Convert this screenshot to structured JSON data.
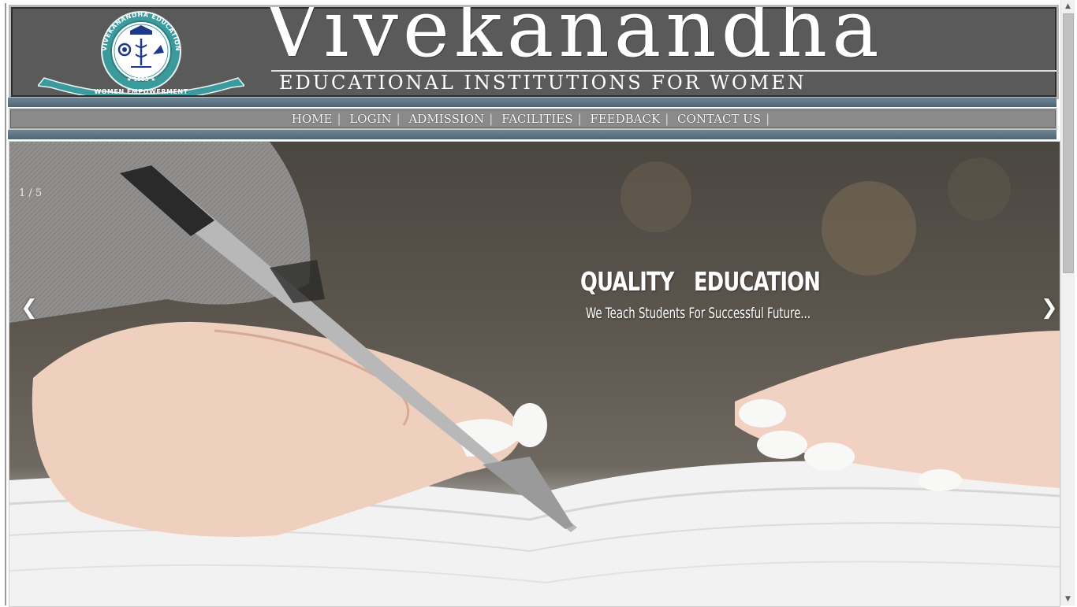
{
  "header": {
    "brand_title": "Vivekanandha",
    "brand_subtitle": "EDUCATIONAL INSTITUTIONS FOR WOMEN",
    "logo_text": "VIVEKANANDHA EDUCATIONAL INSTITUTIONS FOR",
    "logo_year": "★ 1993 ★",
    "logo_ribbon": "WOMEN EMPOWERMENT"
  },
  "nav": {
    "items": [
      {
        "label": "HOME"
      },
      {
        "label": "LOGIN"
      },
      {
        "label": "ADMISSION"
      },
      {
        "label": "FACILITIES"
      },
      {
        "label": "FEEDBACK"
      },
      {
        "label": "CONTACT US"
      }
    ],
    "separator": "|"
  },
  "slider": {
    "counter": "1 / 5",
    "caption_title": "QUALITY EDUCATION",
    "caption_subtitle": "We Teach Students For Successful Future...",
    "prev_label": "❮",
    "next_label": "❯",
    "image_icon": "hand-writing-pen-photo"
  },
  "scrollbar": {
    "up": "▲",
    "down": "▼"
  },
  "colors": {
    "header_bg": "#5a5a5a",
    "nav_bg": "#8a8a8a",
    "band": "#5b7282",
    "logo_teal": "#3b9a9c"
  }
}
